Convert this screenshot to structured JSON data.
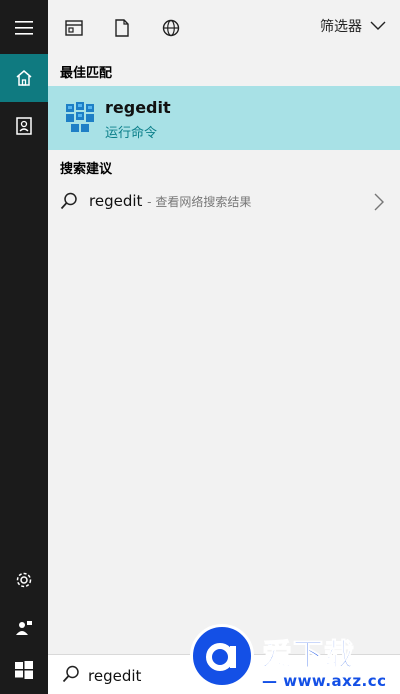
{
  "topbar": {
    "filter_label": "筛选器"
  },
  "sections": {
    "best_match": "最佳匹配",
    "suggestions": "搜索建议"
  },
  "best_match": {
    "title": "regedit",
    "subtitle": "运行命令"
  },
  "suggestion": {
    "term": "regedit",
    "description": "- 查看网络搜索结果"
  },
  "search": {
    "value": "regedit"
  },
  "watermark": {
    "title": "爱下载",
    "domain": "— www.axz.cc —"
  },
  "colors": {
    "rail": "#1b1b1b",
    "rail_active": "#0f7a80",
    "highlight": "#a8e1e6",
    "accent_text": "#0b7f8a",
    "watermark": "#1450e6"
  },
  "icons": {
    "rail": [
      "hamburger-icon",
      "home-icon",
      "notebook-icon",
      "settings-icon",
      "user-feedback-icon",
      "windows-start-icon"
    ],
    "topbar": [
      "apps-icon",
      "document-icon",
      "globe-icon",
      "chevron-down-icon"
    ],
    "best_match": "registry-editor-icon",
    "suggestion": [
      "search-icon",
      "chevron-right-icon"
    ],
    "searchbar": "search-icon"
  }
}
